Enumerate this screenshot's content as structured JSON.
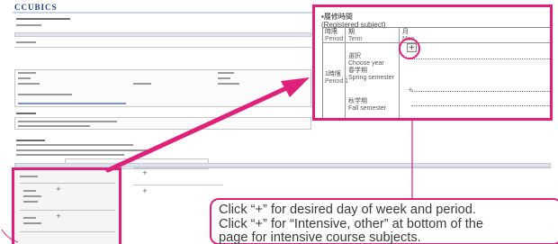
{
  "app": {
    "logo_text": "CCUBICS"
  },
  "inset": {
    "heading_jp": "▪履修時間",
    "heading_en": "(Registered subject)",
    "col_period_jp": "時限",
    "col_period_en": "Period",
    "col_term_jp": "期",
    "col_term_en": "Term",
    "col_day_jp": "月",
    "col_day_en": "Mon",
    "plus_symbol": "+",
    "period_jp": "1時限",
    "period_en": "Period 1",
    "entry1_jp": "選択",
    "entry1_en": "Choose year",
    "entry1b_jp": "春学期",
    "entry1b_en": "Spring semester",
    "entry2_jp": "秋学期",
    "entry2_en": "Fall semester"
  },
  "callout": {
    "line1": "Click “+” for desired day of week and period.",
    "line2": "Click “+” for “Intensive, other” at bottom of the",
    "line3": "page  for intensive course subjects."
  },
  "colors": {
    "highlight": "#e0217c",
    "logo": "#1f3f7a"
  }
}
